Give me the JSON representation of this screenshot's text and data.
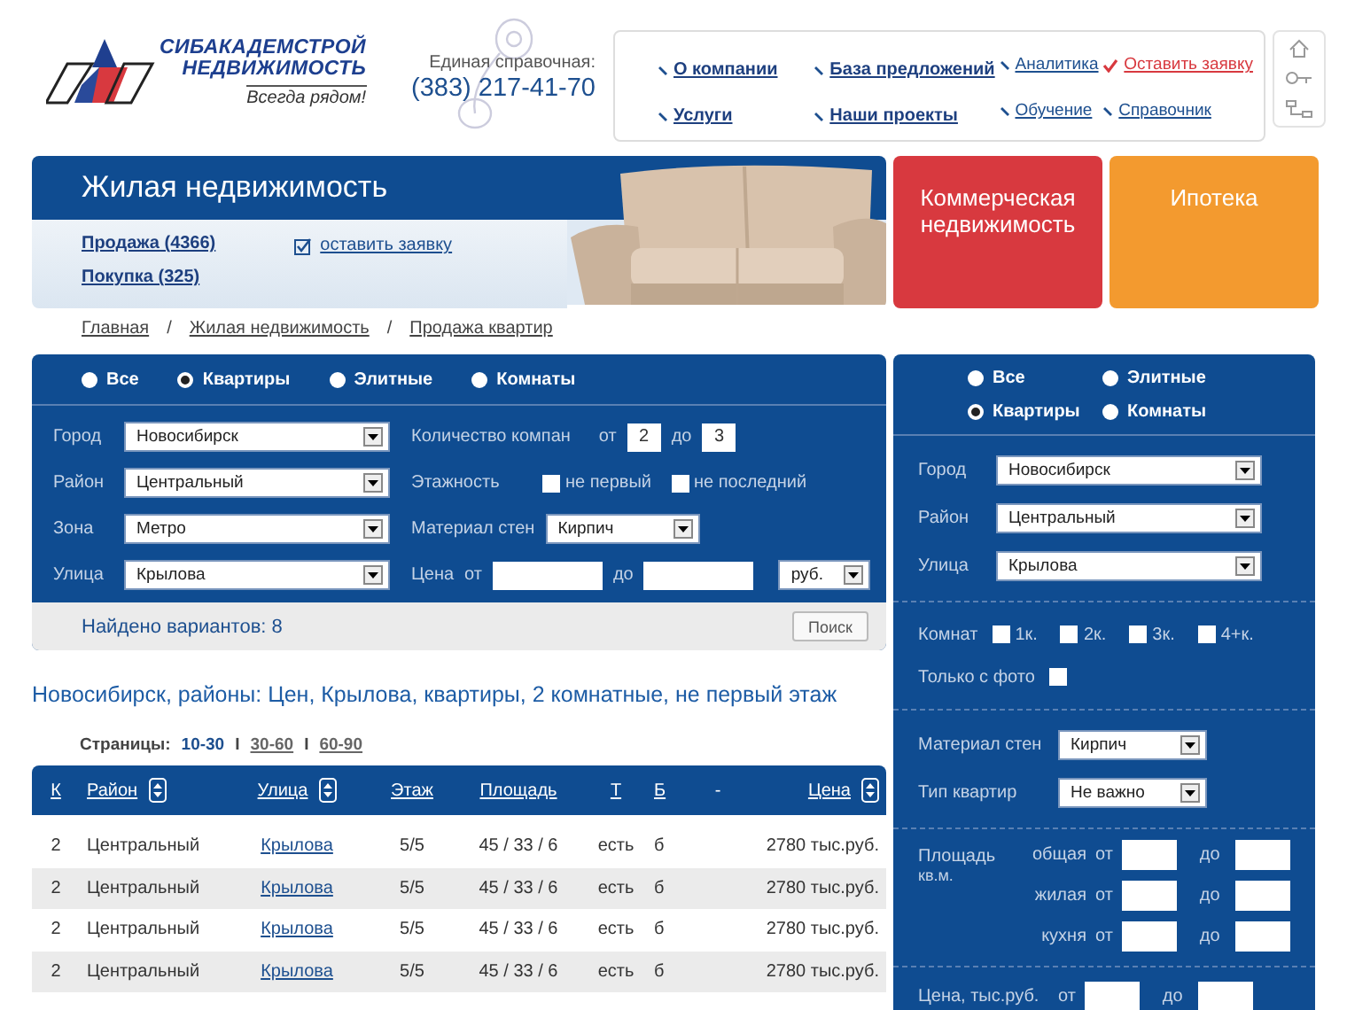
{
  "header": {
    "brand_lines": [
      "СИБАКАДЕМСТРОЙ",
      "НЕДВИЖИМОСТЬ"
    ],
    "tagline": "Всегда рядом!",
    "phone_label": "Единая справочная:",
    "phone": "(383) 217-41-70",
    "nav": [
      {
        "label": "О компании",
        "kind": "main"
      },
      {
        "label": "База предложений",
        "kind": "main"
      },
      {
        "label": "Аналитика",
        "kind": "minor"
      },
      {
        "label": "Оставить заявку",
        "kind": "action"
      },
      {
        "label": "Услуги",
        "kind": "main"
      },
      {
        "label": "Наши проекты",
        "kind": "main"
      },
      {
        "label": "Обучение",
        "kind": "minor"
      },
      {
        "label": "Справочник",
        "kind": "minor"
      }
    ]
  },
  "banner": {
    "title": "Жилая недвижимость",
    "links": [
      "Продажа (4366)",
      "Покупка (325)"
    ],
    "request": "оставить заявку"
  },
  "tiles": [
    {
      "label": "Коммерческая недвижимость",
      "color": "#d8393f"
    },
    {
      "label": "Ипотека",
      "color": "#f39a2f"
    }
  ],
  "breadcrumb": {
    "separator": "/",
    "items": [
      "Главная",
      "Жилая недвижимость",
      "Продажа квартир"
    ]
  },
  "filter": {
    "types": [
      {
        "label": "Все",
        "selected": false
      },
      {
        "label": "Квартиры",
        "selected": true
      },
      {
        "label": "Элитные",
        "selected": false
      },
      {
        "label": "Комнаты",
        "selected": false
      }
    ],
    "selects": [
      {
        "label": "Город",
        "value": "Новосибирск"
      },
      {
        "label": "Район",
        "value": "Центральный"
      },
      {
        "label": "Зона",
        "value": "Метро"
      },
      {
        "label": "Улица",
        "value": "Крылова"
      }
    ],
    "rooms": {
      "label": "Количество компан",
      "from": "от",
      "from_value": "2",
      "to": "до",
      "to_value": "3"
    },
    "floors": {
      "label": "Этажность",
      "options": [
        {
          "label": "не первый",
          "checked": false
        },
        {
          "label": "не последний",
          "checked": false
        }
      ]
    },
    "material": {
      "label": "Материал стен",
      "value": "Кирпич"
    },
    "price": {
      "label": "Цена",
      "from": "от",
      "to": "до",
      "currency": "руб."
    },
    "found": "Найдено вариантов: 8",
    "search_button": "Поиск"
  },
  "results": {
    "heading": "Новосибирск, районы: Цен, Крылова, квартиры, 2 комнатные, не первый этаж",
    "pages_label": "Страницы:",
    "pages": [
      {
        "label": "10-30",
        "selected": true
      },
      {
        "separator": "I",
        "label": "30-60",
        "selected": false
      },
      {
        "separator": "I",
        "label": "60-90",
        "selected": false
      }
    ]
  },
  "table": {
    "columns": [
      {
        "label": "К",
        "link": true,
        "sortable": false,
        "kind": "text"
      },
      {
        "label": "Район",
        "link": true,
        "sortable": true,
        "kind": "text"
      },
      {
        "label": "Улица",
        "link": true,
        "sortable": true,
        "kind": "link"
      },
      {
        "label": "Этаж",
        "link": true,
        "sortable": false,
        "kind": "text"
      },
      {
        "label": "Площадь",
        "link": true,
        "sortable": false,
        "kind": "text"
      },
      {
        "label": "Т",
        "link": true,
        "sortable": false,
        "kind": "text"
      },
      {
        "label": "Б",
        "link": true,
        "sortable": false,
        "kind": "text"
      },
      {
        "label": "-",
        "link": false
      },
      {
        "label": "Цена",
        "link": true,
        "sortable": true,
        "kind": "text"
      }
    ],
    "rows": [
      [
        "2",
        "Центральный",
        "Крылова",
        "5/5",
        "45 / 33 / 6",
        "есть",
        "б",
        "",
        "2780 тыс.руб."
      ],
      [
        "2",
        "Центральный",
        "Крылова",
        "5/5",
        "45 / 33 / 6",
        "есть",
        "б",
        "",
        "2780 тыс.руб."
      ],
      [
        "2",
        "Центральный",
        "Крылова",
        "5/5",
        "45 / 33 / 6",
        "есть",
        "б",
        "",
        "2780 тыс.руб."
      ],
      [
        "2",
        "Центральный",
        "Крылова",
        "5/5",
        "45 / 33 / 6",
        "есть",
        "б",
        "",
        "2780 тыс.руб."
      ]
    ]
  },
  "side": {
    "types": [
      {
        "label": "Все",
        "selected": false
      },
      {
        "label": "Элитные",
        "selected": false
      },
      {
        "label": "Квартиры",
        "selected": true
      },
      {
        "label": "Комнаты",
        "selected": false
      }
    ],
    "selects": [
      {
        "label": "Город",
        "value": "Новосибирск"
      },
      {
        "label": "Район",
        "value": "Центральный"
      },
      {
        "label": "Улица",
        "value": "Крылова"
      }
    ],
    "rooms": {
      "label": "Комнат",
      "options": [
        {
          "label": "1к.",
          "checked": false
        },
        {
          "label": "2к.",
          "checked": false
        },
        {
          "label": "3к.",
          "checked": false
        },
        {
          "label": "4+к.",
          "checked": false
        }
      ]
    },
    "photo": {
      "label": "Только с фото",
      "checked": false
    },
    "selects2": [
      {
        "label": "Материал стен",
        "value": "Кирпич"
      },
      {
        "label": "Тип квартир",
        "value": "Не важно"
      }
    ],
    "area": {
      "label": "Площадь",
      "unit": "кв.м.",
      "rows": [
        {
          "name": "общая",
          "from": "от",
          "to": "до"
        },
        {
          "name": "жилая",
          "from": "от",
          "to": "до"
        },
        {
          "name": "кухня",
          "from": "от",
          "to": "до"
        }
      ]
    },
    "price": {
      "label": "Цена, тыс.руб.",
      "from": "от",
      "to": "до"
    }
  }
}
